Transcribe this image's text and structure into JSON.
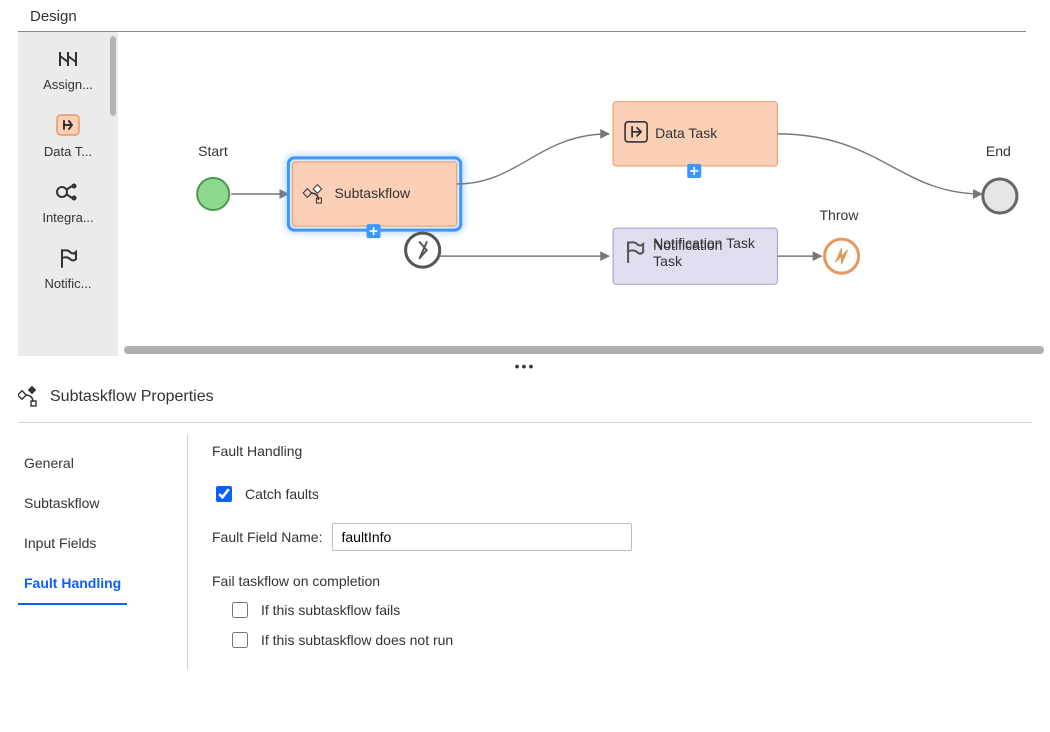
{
  "page_title": "Design",
  "palette": {
    "items": [
      {
        "label": "Assign...",
        "icon": "assignment"
      },
      {
        "label": "Data T...",
        "icon": "data-task"
      },
      {
        "label": "Integra...",
        "icon": "integration"
      },
      {
        "label": "Notific...",
        "icon": "flag"
      }
    ]
  },
  "flow": {
    "start_label": "Start",
    "end_label": "End",
    "subtaskflow_label": "Subtaskflow",
    "data_task_label": "Data Task",
    "notification_label": "Notification Task",
    "throw_label": "Throw"
  },
  "properties": {
    "header": "Subtaskflow Properties",
    "tabs": [
      "General",
      "Subtaskflow",
      "Input Fields",
      "Fault Handling"
    ],
    "active_tab": "Fault Handling",
    "fault": {
      "section_title": "Fault Handling",
      "catch_label": "Catch faults",
      "catch_checked": true,
      "field_label": "Fault Field Name:",
      "field_value": "faultInfo",
      "fail_section": "Fail taskflow on completion",
      "opt1_label": "If this subtaskflow fails",
      "opt1_checked": false,
      "opt2_label": "If this subtaskflow does not run",
      "opt2_checked": false
    }
  }
}
